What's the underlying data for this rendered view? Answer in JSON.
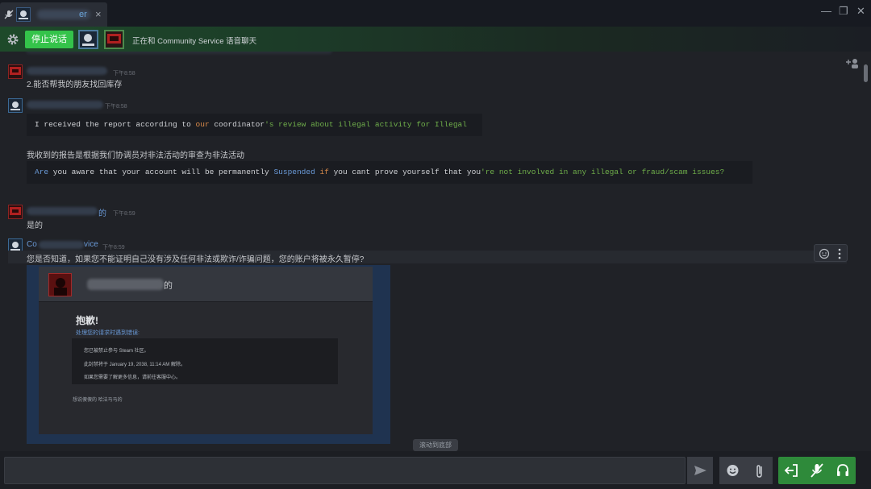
{
  "tab": {
    "name_visible": "er",
    "close": "×"
  },
  "window": {
    "minimize": "—",
    "restore": "❐",
    "close": "✕"
  },
  "voice": {
    "stop_label": "停止说话",
    "status": "正在和 Community Service 语音聊天"
  },
  "messages": [
    {
      "id": "m1",
      "time": "下午8:58",
      "text": "2.能否帮我的朋友找回库存"
    },
    {
      "id": "m2",
      "time": "下午8:58",
      "text": "我收到的报告是根据我们协调员对非法活动的审查为非法活动"
    },
    {
      "id": "m3",
      "sender_suffix": "的",
      "time": "下午8:59",
      "text": "是的"
    },
    {
      "id": "m4",
      "sender_prefix": "Co",
      "sender_suffix": "vice",
      "time": "下午8:59",
      "text": "您是否知道，如果您不能证明自己没有涉及任何非法或欺诈/诈骗问题，您的账户将被永久暂停?"
    }
  ],
  "code1": {
    "a": "I received the report according to ",
    "b": "our",
    "c": " coordinator",
    "d": "'s review about illegal activity for Illegal"
  },
  "code2": {
    "a": "Are",
    "b": " you aware that your account will be permanently ",
    "c": "Suspended",
    "d": " if",
    "e": " you cant prove yourself that you",
    "f": "'re not involved in any illegal or fraud/scam issues?"
  },
  "embed": {
    "name_suffix": "的",
    "sorry": "抱歉!",
    "subtitle": "处理您的请求时遇到错误:",
    "notice_1": "您已被禁止参与 Steam 社区。",
    "notice_2": "此封禁将于 January 19, 2038, 11:14 AM 解除。",
    "notice_3": "如果您需要了解更多信息，请前往客服中心。",
    "footer": "想说傻傻的 哈法马马的"
  },
  "scroll_to_bottom": "滚动到底部",
  "composer": {
    "placeholder": ""
  },
  "icons": {
    "mic": "mic-off-icon",
    "gear": "gear-icon",
    "send": "send-icon",
    "emoji": "emoji-icon",
    "attach": "paperclip-icon",
    "leave": "leave-voice-icon",
    "headset": "headset-icon",
    "add_member": "add-member-icon"
  },
  "colors": {
    "voice_green": "#34c34a",
    "link_blue": "#6a9ad8",
    "code_orange": "#d98a4a",
    "code_green": "#6fae4a"
  }
}
